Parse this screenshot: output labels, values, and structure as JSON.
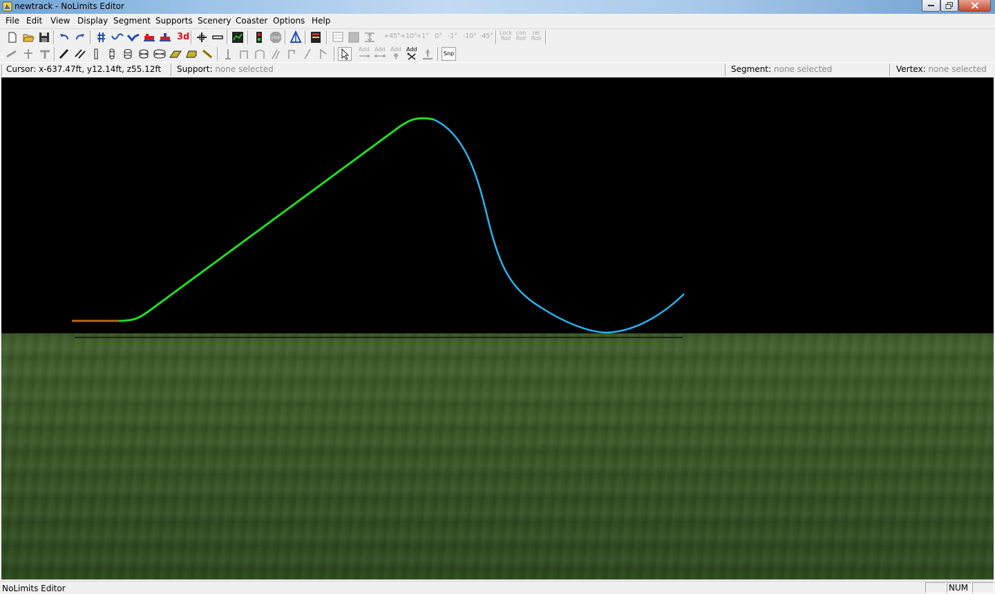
{
  "window": {
    "title": "newtrack - NoLimits Editor"
  },
  "menu": [
    "File",
    "Edit",
    "View",
    "Display",
    "Segment",
    "Supports",
    "Scenery",
    "Coaster",
    "Options",
    "Help"
  ],
  "toolbar1": {
    "angle_buttons": [
      "+45°",
      "+10°",
      "+1°",
      "0°",
      "-1°",
      "-10°",
      "-45°"
    ],
    "lock_roll": {
      "top": "Lock",
      "bottom": "Roll"
    },
    "con_roll": {
      "top": "con",
      "bottom": "Roll"
    },
    "rel_roll": {
      "top": "rel",
      "bottom": "Roll"
    },
    "button_3d": "3d"
  },
  "toolbar2": {
    "add_buttons": [
      "Add",
      "Add",
      "Add",
      "Add"
    ],
    "snap": "Snp"
  },
  "info": {
    "cursor_label": "Cursor:",
    "cursor_value": "x-637.47ft, y12.14ft, z55.12ft",
    "support_label": "Support:",
    "support_value": "none selected",
    "segment_label": "Segment:",
    "segment_value": "none selected",
    "vertex_label": "Vertex:",
    "vertex_value": "none selected"
  },
  "track": {
    "colors": {
      "station": "#b46a16",
      "selected": "#22dd22",
      "track": "#2ab4f0",
      "ground_line": "#111111"
    }
  },
  "status": {
    "text": "NoLimits Editor",
    "num": "NUM"
  }
}
